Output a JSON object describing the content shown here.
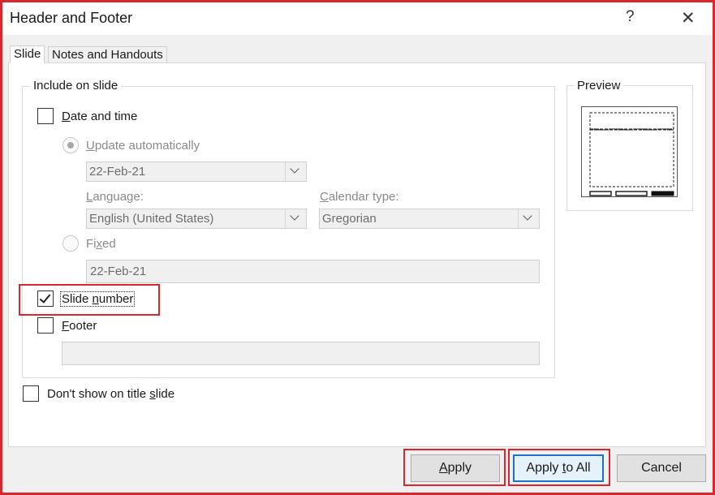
{
  "window": {
    "title": "Header and Footer",
    "help_glyph": "?",
    "close_glyph": "✕"
  },
  "tabs": [
    {
      "label": "Slide",
      "active": true
    },
    {
      "label": "Notes and Handouts",
      "active": false
    }
  ],
  "include": {
    "legend": "Include on slide",
    "date_time": {
      "label": "Date and time",
      "underline": "D",
      "rest": "ate and time",
      "checked": false
    },
    "update_auto": {
      "label": "Update automatically",
      "underline": "U",
      "rest": "pdate automatically",
      "selected": true,
      "enabled": false
    },
    "date_format": {
      "value": "22-Feb-21"
    },
    "language": {
      "label": "Language:",
      "underline": "L",
      "rest": "anguage:",
      "value": "English (United States)"
    },
    "calendar": {
      "label": "Calendar type:",
      "underline": "C",
      "rest": "alendar type:",
      "value": "Gregorian"
    },
    "fixed": {
      "label": "Fixed",
      "pre": "Fi",
      "underline": "x",
      "rest": "ed",
      "selected": false,
      "value": "22-Feb-21"
    },
    "slide_number": {
      "label": "Slide number",
      "pre": "Slide ",
      "underline": "n",
      "rest": "umber",
      "checked": true
    },
    "footer": {
      "label": "Footer",
      "underline": "F",
      "rest": "ooter",
      "checked": false,
      "value": ""
    }
  },
  "dont_show": {
    "label": "Don't show on title slide",
    "pre": "Don't show on title ",
    "underline": "s",
    "rest": "lide",
    "checked": false
  },
  "preview": {
    "legend": "Preview"
  },
  "buttons": {
    "apply": {
      "underline": "A",
      "rest": "pply"
    },
    "apply_all": {
      "pre": "Apply ",
      "underline": "t",
      "rest": "o All"
    },
    "cancel": {
      "label": "Cancel"
    }
  },
  "colors": {
    "highlight": "#d7282f",
    "default_button_border": "#1e73c8"
  }
}
